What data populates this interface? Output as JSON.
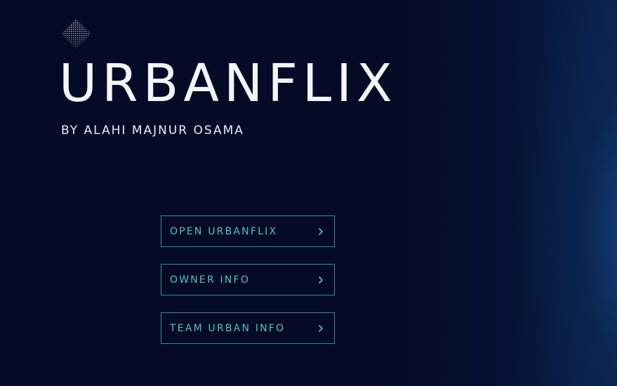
{
  "app": {
    "title": "URBANFLIX",
    "subtitle": "BY ALAHI MAJNUR OSAMA",
    "logo_icon": "diamond-dither-icon"
  },
  "menu": {
    "items": [
      {
        "label": "OPEN URBANFLIX",
        "icon": "chevron-right-icon"
      },
      {
        "label": "OWNER INFO",
        "icon": "chevron-right-icon"
      },
      {
        "label": "TEAM URBAN INFO",
        "icon": "chevron-right-icon"
      }
    ]
  },
  "colors": {
    "background": "#050b26",
    "accent": "#4fc3c5",
    "border": "#2f8f99",
    "text": "#f2f5fa"
  }
}
